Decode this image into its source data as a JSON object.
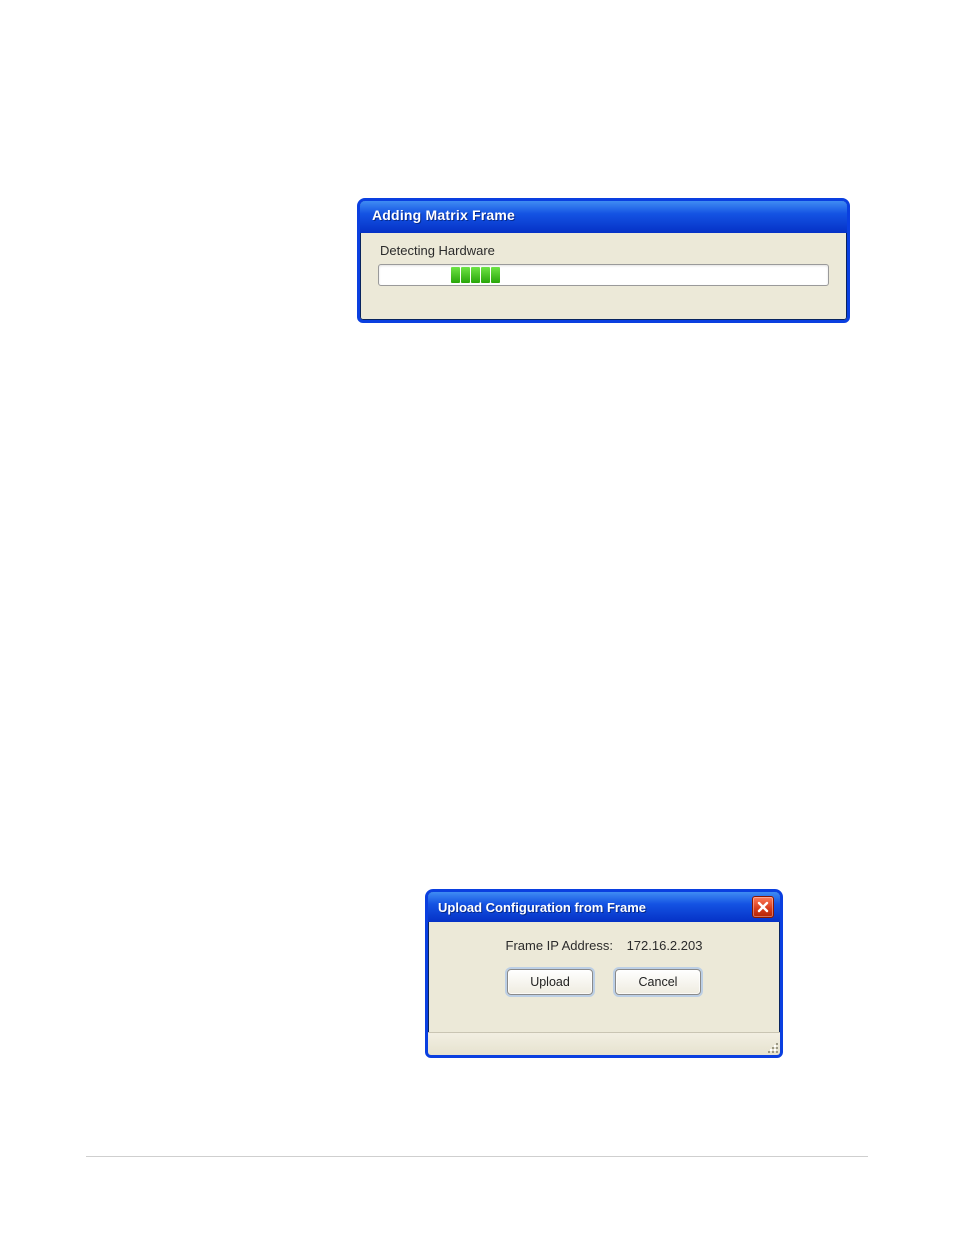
{
  "dialog1": {
    "title": "Adding Matrix Frame",
    "status_text": "Detecting Hardware",
    "progress": {
      "visible_blocks": 5,
      "block_color": "#3bbf1a"
    }
  },
  "dialog2": {
    "title": "Upload Configuration from Frame",
    "ip_label": "Frame IP Address:",
    "ip_value": "172.16.2.203",
    "buttons": {
      "upload_label": "Upload",
      "cancel_label": "Cancel"
    },
    "close_icon": "close-icon"
  }
}
